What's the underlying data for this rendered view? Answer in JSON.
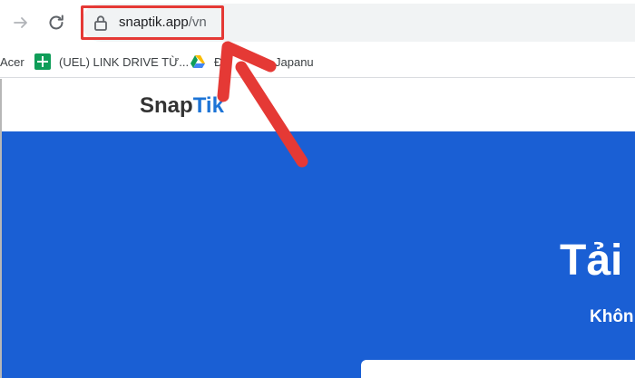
{
  "browser": {
    "url_host": "snaptik.app",
    "url_path": "/vn",
    "bookmarks": [
      {
        "label": "Acer"
      },
      {
        "label": "(UEL) LINK DRIVE TỪ..."
      },
      {
        "label": "ĐT"
      },
      {
        "label": "Japanu"
      }
    ]
  },
  "page": {
    "logo_part1": "Snap",
    "logo_part2": "Tik",
    "hero_title": "Tải",
    "hero_subtitle": "Khôn"
  },
  "colors": {
    "hero_blue": "#1a5fd4",
    "logo_blue": "#1d74d6",
    "annotation_red": "#e53935"
  }
}
